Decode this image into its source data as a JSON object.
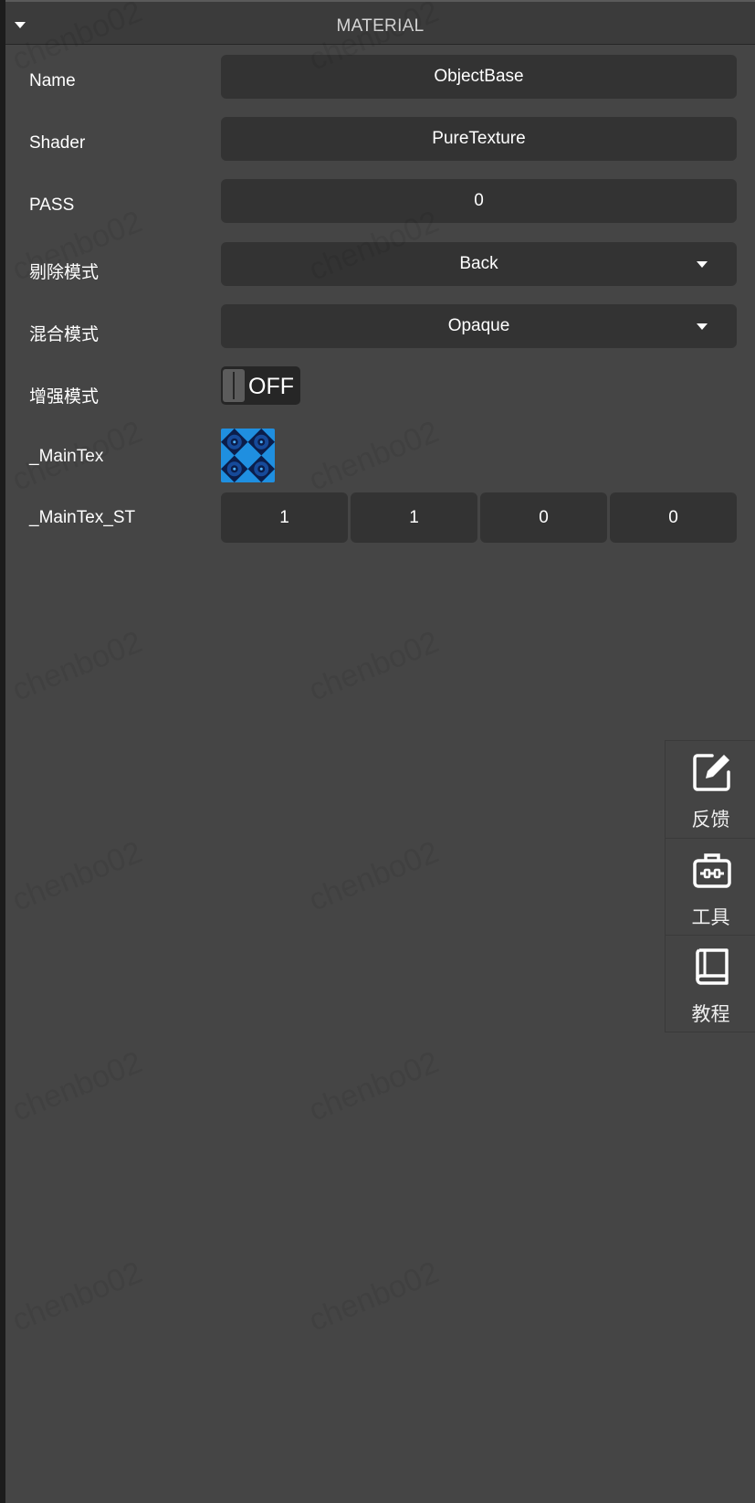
{
  "panel": {
    "title": "MATERIAL",
    "collapse_icon": "caret-down-icon"
  },
  "properties": {
    "name": {
      "label": "Name",
      "value": "ObjectBase"
    },
    "shader": {
      "label": "Shader",
      "value": "PureTexture"
    },
    "pass": {
      "label": "PASS",
      "value": "0"
    },
    "cull": {
      "label": "剔除模式",
      "value": "Back"
    },
    "blend": {
      "label": "混合模式",
      "value": "Opaque"
    },
    "enhance": {
      "label": "增强模式",
      "value": "OFF"
    },
    "main_tex": {
      "label": "_MainTex",
      "thumbnail": "blue-pattern-texture"
    },
    "main_tex_st": {
      "label": "_MainTex_ST",
      "values": [
        "1",
        "1",
        "0",
        "0"
      ]
    }
  },
  "side_tools": [
    {
      "label": "反馈",
      "icon": "edit-icon"
    },
    {
      "label": "工具",
      "icon": "toolbox-icon"
    },
    {
      "label": "教程",
      "icon": "book-icon"
    }
  ],
  "watermark": "chenbo02",
  "colors": {
    "background": "#454545",
    "field": "#333333",
    "header": "#3b3b3b",
    "texture_blue": "#1f8fe0",
    "texture_dark": "#0b1d4a"
  }
}
